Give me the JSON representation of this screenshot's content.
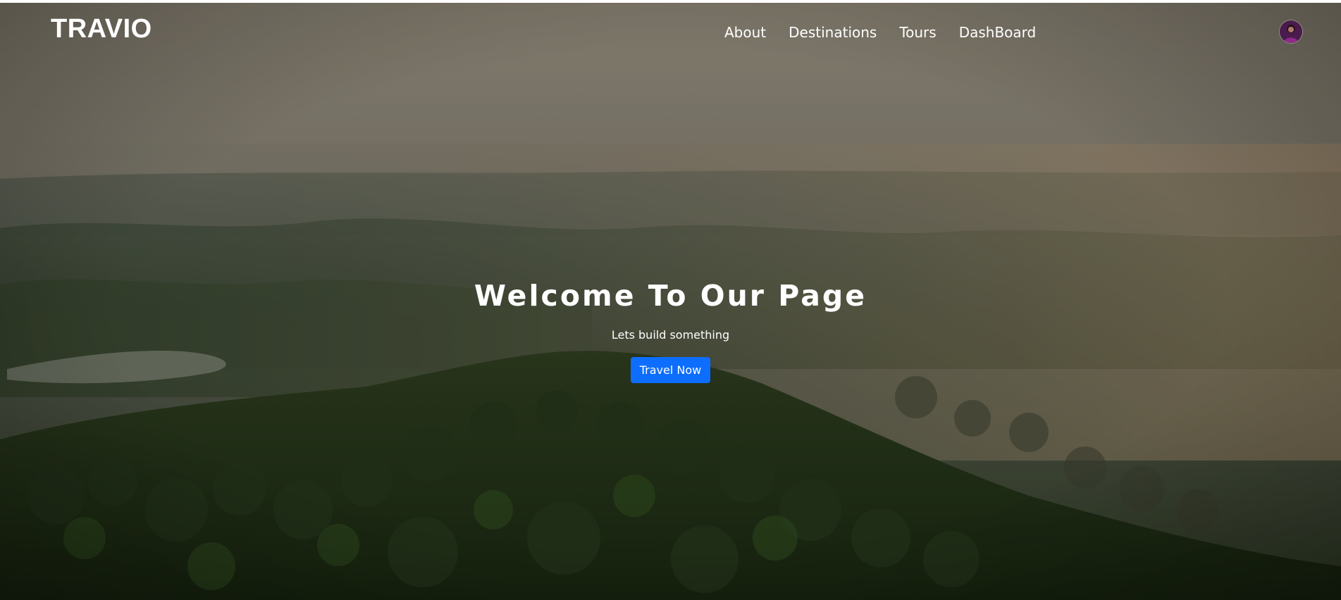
{
  "header": {
    "brand": "TRAVIO",
    "nav_items": [
      {
        "label": "About"
      },
      {
        "label": "Destinations"
      },
      {
        "label": "Tours"
      },
      {
        "label": "DashBoard"
      }
    ],
    "avatar_icon": "user-avatar-icon"
  },
  "hero": {
    "title": "Welcome To Our Page",
    "subtitle": "Lets build something",
    "cta_label": "Travel Now"
  },
  "colors": {
    "cta": "#0d6efd",
    "text": "#ffffff"
  }
}
